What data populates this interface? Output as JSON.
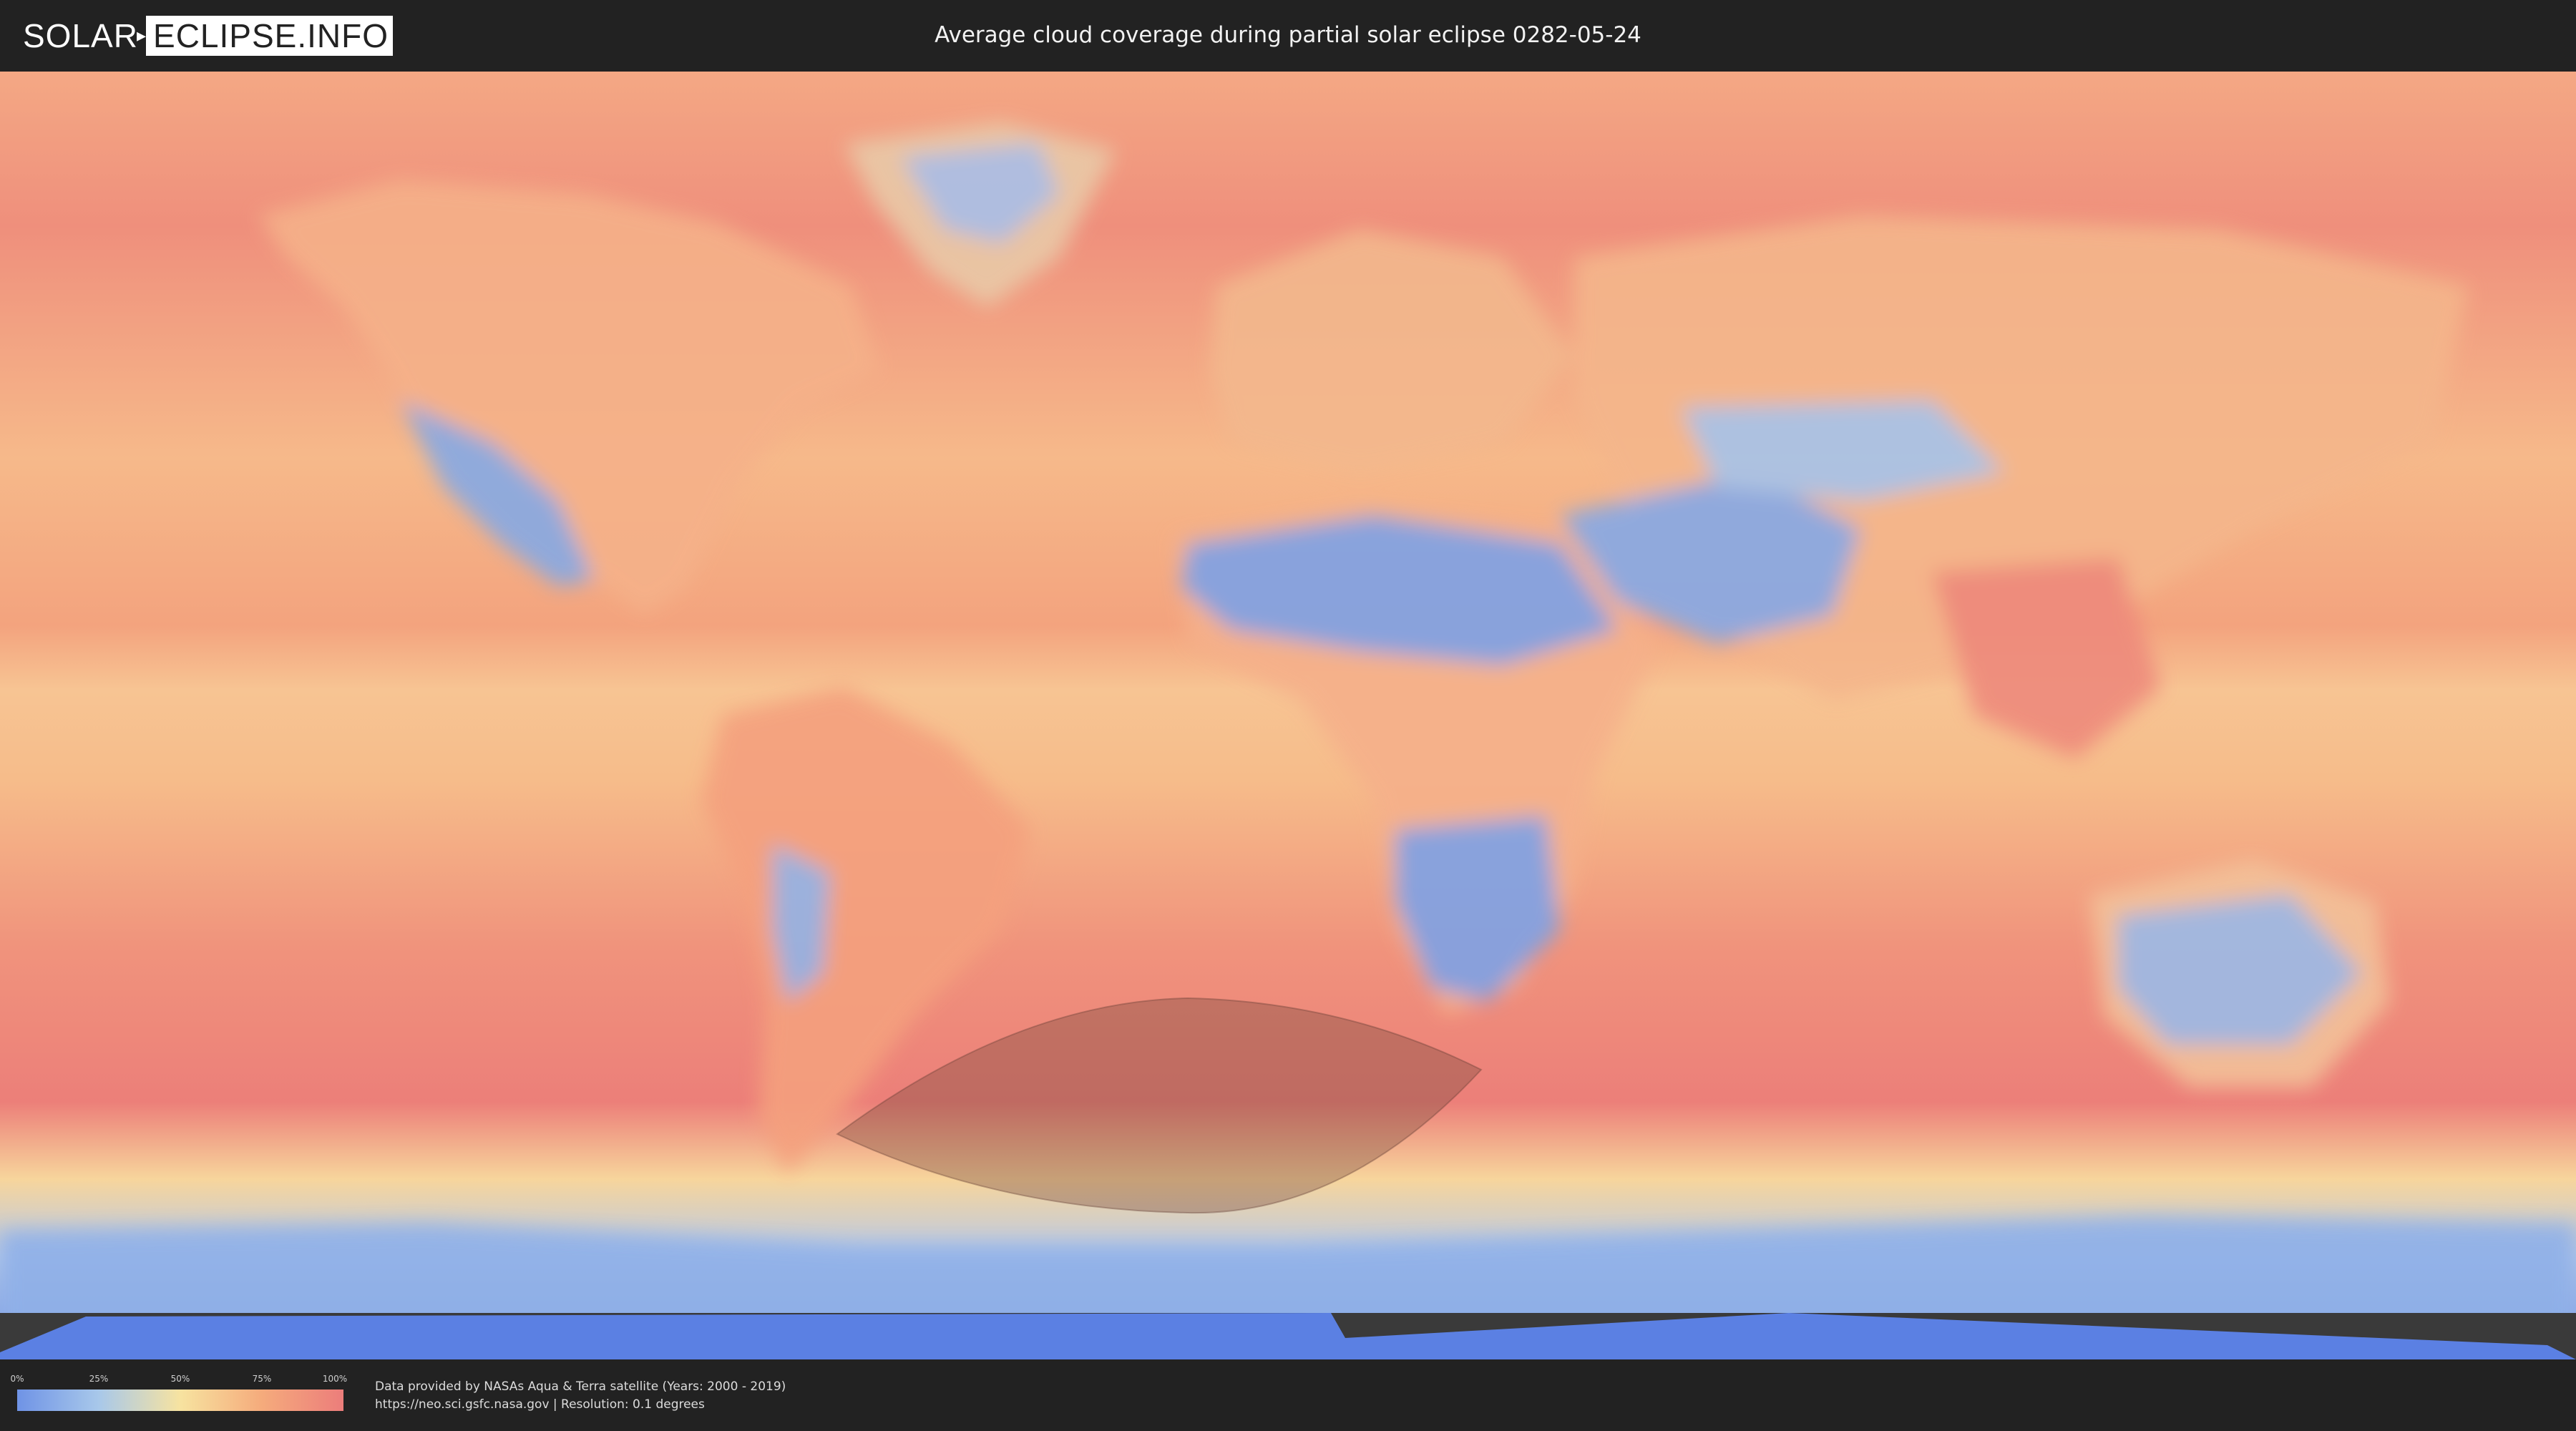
{
  "header": {
    "logo_left": "SOLAR",
    "logo_right": "ECLIPSE.INFO",
    "title": "Average cloud coverage during partial solar eclipse 0282-05-24"
  },
  "legend": {
    "ticks": [
      "0%",
      "25%",
      "50%",
      "75%",
      "100%"
    ],
    "colors": [
      "#6f93e6",
      "#a8c8ea",
      "#f7e3a0",
      "#f5ab7c",
      "#ec7d7b"
    ]
  },
  "credits": {
    "line1": "Data provided by NASAs Aqua & Terra satellite (Years: 2000 - 2019)",
    "line2": "https://neo.sci.gsfc.nasa.gov | Resolution: 0.1 degrees"
  },
  "map": {
    "colors": {
      "ocean_cloudy": "#ef8f7c",
      "ocean_mid": "#f6b988",
      "clear_land": "#7aa2e6",
      "antarctica": "#5b80e3",
      "eclipse_shadow": "#8a5a4a"
    }
  }
}
